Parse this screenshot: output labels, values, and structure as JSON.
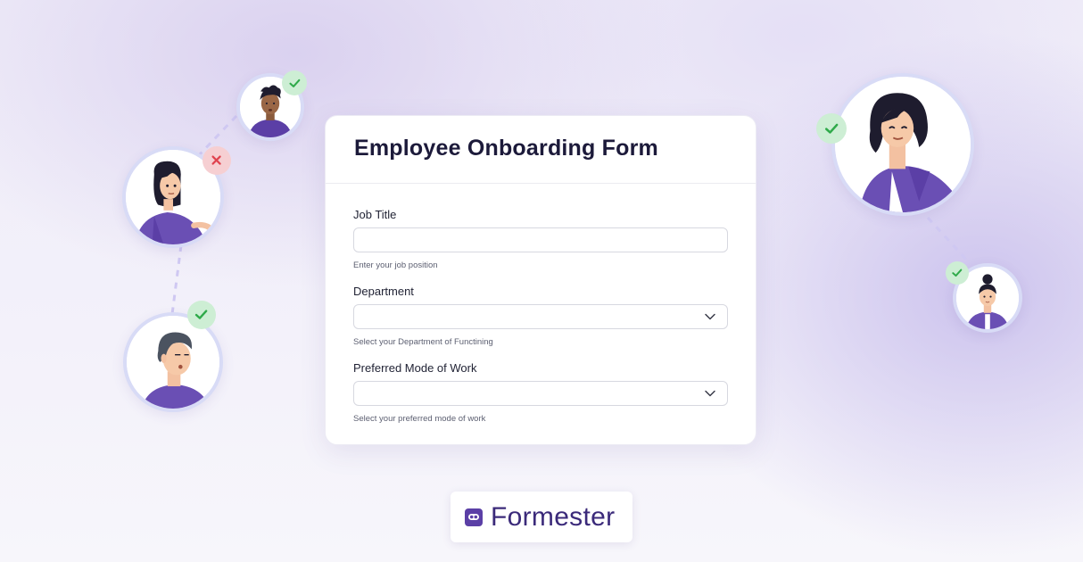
{
  "form": {
    "title": "Employee Onboarding Form",
    "fields": [
      {
        "label": "Job Title",
        "type": "text",
        "value": "",
        "placeholder": "",
        "help": "Enter your job position"
      },
      {
        "label": "Department",
        "type": "select",
        "value": "",
        "help": "Select your Department of Functining"
      },
      {
        "label": "Preferred Mode of Work",
        "type": "select",
        "value": "",
        "help": "Select your preferred mode of work"
      }
    ]
  },
  "brand": {
    "name": "Formester"
  },
  "avatars": [
    {
      "id": "man-dark-hair",
      "status": "approved"
    },
    {
      "id": "woman-long-hair",
      "status": "rejected"
    },
    {
      "id": "man-gray-hair",
      "status": "approved"
    },
    {
      "id": "woman-bob-hair",
      "status": "approved"
    },
    {
      "id": "woman-bun-hair",
      "status": "approved"
    }
  ],
  "colors": {
    "accent": "#5b3fa6",
    "approved_badge": "#cdeed4",
    "approved_check": "#2faa4a",
    "rejected_badge": "#f6cfd2",
    "rejected_x": "#e0434f",
    "avatar_ring": "#d8dbf6",
    "title_text": "#1c1a3a",
    "brand_text": "#3b2a7a"
  }
}
